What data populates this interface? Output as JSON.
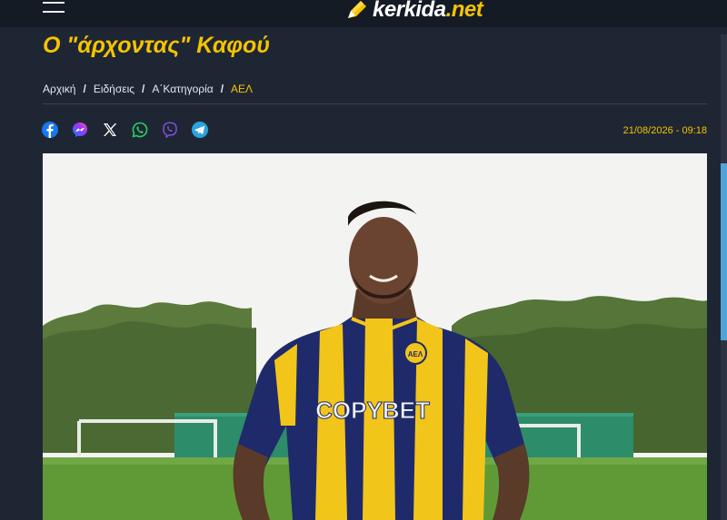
{
  "header": {
    "logo_main": "kerkida",
    "logo_suffix": ".net",
    "menu_icon": "hamburger-icon"
  },
  "article": {
    "title": "Ο \"άρχοντας\" Καφού",
    "date": "21/08/2026 - 09:18",
    "photo_text": {
      "sponsor": "COPYBET",
      "crest": "AEΛ"
    }
  },
  "breadcrumb": {
    "items": [
      "Αρχική",
      "Ειδήσεις",
      "Α΄Κατηγορία",
      "ΑΕΛ"
    ],
    "separator": "/"
  },
  "share": {
    "icons": [
      "facebook-icon",
      "messenger-icon",
      "x-icon",
      "whatsapp-icon",
      "viber-icon",
      "telegram-icon"
    ]
  },
  "colors": {
    "accent": "#f5c400",
    "background": "#1f2633",
    "topbar": "#151b25"
  }
}
